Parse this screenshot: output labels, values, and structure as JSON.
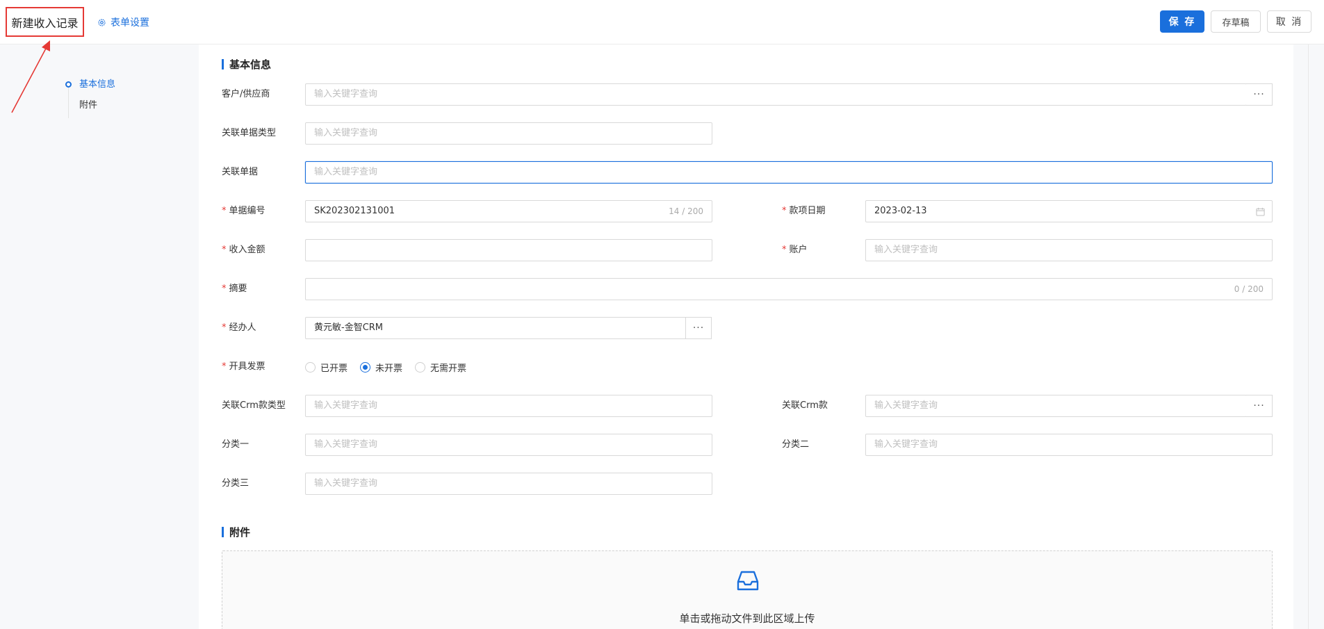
{
  "header": {
    "title": "新建收入记录",
    "form_settings_label": "表单设置",
    "save_label": "保 存",
    "draft_label": "存草稿",
    "cancel_label": "取 消"
  },
  "anchor_nav": {
    "items": [
      {
        "label": "基本信息",
        "active": true
      },
      {
        "label": "附件",
        "active": false
      }
    ]
  },
  "sections": {
    "basic": "基本信息",
    "attachments": "附件"
  },
  "fields": {
    "customer_supplier": {
      "label": "客户/供应商",
      "placeholder": "输入关键字查询",
      "value": ""
    },
    "related_doc_type": {
      "label": "关联单据类型",
      "placeholder": "输入关键字查询",
      "value": ""
    },
    "related_doc": {
      "label": "关联单据",
      "placeholder": "输入关键字查询",
      "value": ""
    },
    "doc_number": {
      "label": "单据编号",
      "value": "SK202302131001",
      "counter": "14 / 200",
      "required": true
    },
    "payment_date": {
      "label": "款项日期",
      "value": "2023-02-13",
      "required": true
    },
    "income_amount": {
      "label": "收入金额",
      "value": "",
      "required": true
    },
    "account": {
      "label": "账户",
      "placeholder": "输入关键字查询",
      "value": "",
      "required": true
    },
    "summary": {
      "label": "摘要",
      "value": "",
      "counter": "0 / 200",
      "required": true
    },
    "handler": {
      "label": "经办人",
      "value": "黄元敏-金智CRM",
      "required": true
    },
    "invoice": {
      "label": "开具发票",
      "required": true,
      "options": [
        "已开票",
        "未开票",
        "无需开票"
      ],
      "selected": "未开票"
    },
    "related_crm_type": {
      "label": "关联Crm款类型",
      "placeholder": "输入关键字查询",
      "value": ""
    },
    "related_crm": {
      "label": "关联Crm款",
      "placeholder": "输入关键字查询",
      "value": ""
    },
    "category1": {
      "label": "分类一",
      "placeholder": "输入关键字查询",
      "value": ""
    },
    "category2": {
      "label": "分类二",
      "placeholder": "输入关键字查询",
      "value": ""
    },
    "category3": {
      "label": "分类三",
      "placeholder": "输入关键字查询",
      "value": ""
    }
  },
  "more_button_glyph": "···",
  "required_mark": "*",
  "upload": {
    "text": "单击或拖动文件到此区域上传"
  },
  "colors": {
    "primary": "#1a6fdc",
    "required": "#e53935",
    "annotation": "#e53935"
  }
}
